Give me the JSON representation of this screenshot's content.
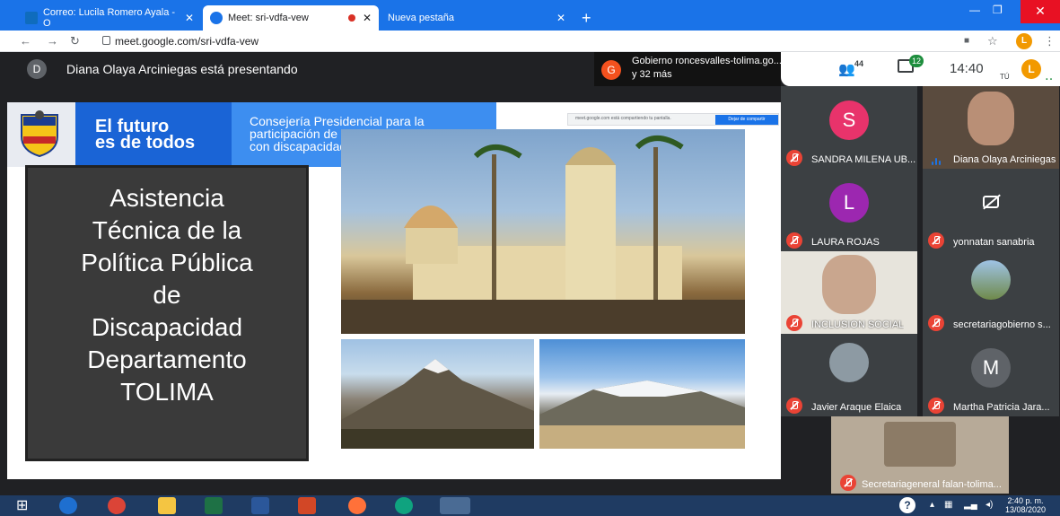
{
  "browser": {
    "tabs": [
      {
        "label": "Correo: Lucila Romero Ayala - O"
      },
      {
        "label": "Meet: sri-vdfa-vew"
      },
      {
        "label": "Nueva pestaña"
      }
    ],
    "new_tab_symbol": "+",
    "url": "meet.google.com/sri-vdfa-vew",
    "profile_initial": "L"
  },
  "meet": {
    "presenter_initial": "D",
    "presenting_text": "Diana Olaya Arciniegas está presentando",
    "meeting_initial": "G",
    "meeting_title": "Gobierno roncesvalles-tolima.go...",
    "meeting_more": "y 32 más",
    "people_count": "44",
    "chat_count": "12",
    "clock": "14:40",
    "self_label": "TÚ",
    "self_initial": "L"
  },
  "slide": {
    "banner_left": "El futuro\nes de todos",
    "banner_right": "Consejería Presidencial para la\nparticipación de las personas\ncon discapacidad",
    "title_lines": [
      "Asistencia",
      "Técnica de la",
      "Política Pública",
      "de",
      "Discapacidad",
      "Departamento",
      "TOLIMA"
    ],
    "share_notice": "meet.google.com está compartiendo tu pantalla.",
    "stop_share": "Dejar de compartir"
  },
  "participants": [
    {
      "initial": "S",
      "name": "SANDRA MILENA UB...",
      "color": "#e8336b"
    },
    {
      "initial": "",
      "name": "Diana Olaya Arciniegas",
      "color": ""
    },
    {
      "initial": "L",
      "name": "LAURA ROJAS",
      "color": "#9c27b0"
    },
    {
      "initial": "",
      "name": "yonnatan sanabria",
      "color": ""
    },
    {
      "initial": "",
      "name": "INCLUSION SOCIAL",
      "color": ""
    },
    {
      "initial": "",
      "name": "secretariagobierno s...",
      "color": ""
    },
    {
      "initial": "",
      "name": "Javier Araque Elaica",
      "color": ""
    },
    {
      "initial": "M",
      "name": "Martha Patricia Jara...",
      "color": "#5f6368"
    },
    {
      "initial": "",
      "name": "Secretariageneral falan-tolima...",
      "color": ""
    }
  ],
  "taskbar": {
    "time": "2:40 p. m.",
    "date": "13/08/2020"
  }
}
